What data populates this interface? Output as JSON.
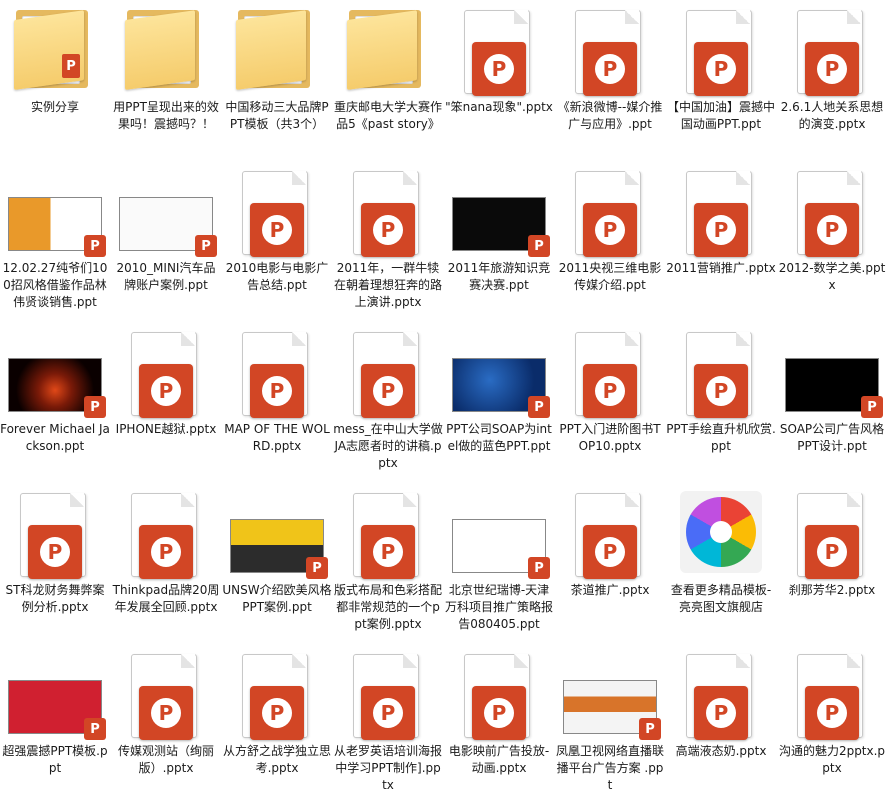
{
  "icons": {
    "ppt_letter": "P",
    "colors": {
      "ppt_red": "#d24625",
      "folder_yellow": "#f5cc6c"
    }
  },
  "files": [
    {
      "label": "实例分享",
      "kind": "folder",
      "icon": "folder-icon"
    },
    {
      "label": "用PPT呈现出来的效果吗！震撼吗？！",
      "kind": "folder",
      "icon": "folder-icon"
    },
    {
      "label": "中国移动三大品牌PPT模板（共3个）",
      "kind": "folder",
      "icon": "folder-icon"
    },
    {
      "label": "重庆邮电大学大赛作品5《past story》",
      "kind": "folder",
      "icon": "folder-icon"
    },
    {
      "label": "\"笨nana现象\".pptx",
      "kind": "doc",
      "icon": "pptx-icon"
    },
    {
      "label": "《新浪微博--媒介推广与应用》.ppt",
      "kind": "doc",
      "icon": "pptx-icon"
    },
    {
      "label": "【中国加油】震撼中国动画PPT.ppt",
      "kind": "doc",
      "icon": "pptx-icon"
    },
    {
      "label": "2.6.1人地关系思想的演变.pptx",
      "kind": "doc",
      "icon": "pptx-icon"
    },
    {
      "label": "12.02.27纯爷们100招风格借鉴作品林伟贤谈销售.ppt",
      "kind": "thumb",
      "thumb": "t-orange",
      "icon": "ppt-thumbnail-icon"
    },
    {
      "label": "2010_MINI汽车品牌账户案例.ppt",
      "kind": "thumb",
      "thumb": "t-white",
      "icon": "ppt-thumbnail-icon"
    },
    {
      "label": "2010电影与电影广告总结.ppt",
      "kind": "doc",
      "icon": "pptx-icon"
    },
    {
      "label": "2011年，一群牛犊在朝着理想狂奔的路上演讲.pptx",
      "kind": "doc",
      "icon": "pptx-icon"
    },
    {
      "label": "2011年旅游知识竞赛决赛.ppt",
      "kind": "thumb",
      "thumb": "t-black",
      "icon": "ppt-thumbnail-icon"
    },
    {
      "label": "2011央视三维电影传媒介绍.ppt",
      "kind": "doc",
      "icon": "pptx-icon"
    },
    {
      "label": "2011营销推广.pptx",
      "kind": "doc",
      "icon": "pptx-icon"
    },
    {
      "label": "2012-数学之美.pptx",
      "kind": "doc",
      "icon": "pptx-icon"
    },
    {
      "label": "Forever Michael Jackson.ppt",
      "kind": "thumb",
      "thumb": "t-fire",
      "icon": "ppt-thumbnail-icon"
    },
    {
      "label": "IPHONE越狱.pptx",
      "kind": "doc",
      "icon": "pptx-icon"
    },
    {
      "label": "MAP OF THE WOLRD.pptx",
      "kind": "doc",
      "icon": "pptx-icon"
    },
    {
      "label": "mess_在中山大学做JA志愿者时的讲稿.pptx",
      "kind": "doc",
      "icon": "pptx-icon"
    },
    {
      "label": "PPT公司SOAP为intel做的蓝色PPT.ppt",
      "kind": "thumb",
      "thumb": "t-intel",
      "icon": "ppt-thumbnail-icon"
    },
    {
      "label": "PPT入门进阶图书TOP10.pptx",
      "kind": "doc",
      "icon": "pptx-icon"
    },
    {
      "label": "PPT手绘直升机欣赏.ppt",
      "kind": "doc",
      "icon": "pptx-icon"
    },
    {
      "label": "SOAP公司广告风格PPT设计.ppt",
      "kind": "thumb",
      "thumb": "t-soap",
      "icon": "ppt-thumbnail-icon"
    },
    {
      "label": "ST科龙财务舞弊案例分析.pptx",
      "kind": "doc",
      "icon": "pptx-icon"
    },
    {
      "label": "Thinkpad品牌20周年发展全回顾.pptx",
      "kind": "doc",
      "icon": "pptx-icon"
    },
    {
      "label": "UNSW介绍欧美风格PPT案例.ppt",
      "kind": "thumb",
      "thumb": "t-unsw",
      "icon": "ppt-thumbnail-icon"
    },
    {
      "label": "版式布局和色彩搭配都非常规范的一个ppt案例.pptx",
      "kind": "doc",
      "icon": "pptx-icon"
    },
    {
      "label": "北京世纪瑞博-天津万科项目推广策略报告080405.ppt",
      "kind": "thumb",
      "thumb": "t-glyph",
      "icon": "ppt-thumbnail-icon"
    },
    {
      "label": "茶道推广.pptx",
      "kind": "doc",
      "icon": "pptx-icon"
    },
    {
      "label": "查看更多精品模板-亮亮图文旗舰店",
      "kind": "store",
      "icon": "store-logo-icon"
    },
    {
      "label": "刹那芳华2.pptx",
      "kind": "doc",
      "icon": "pptx-icon"
    },
    {
      "label": "超强震撼PPT模板.ppt",
      "kind": "thumb",
      "thumb": "t-red",
      "icon": "ppt-thumbnail-icon"
    },
    {
      "label": "传媒观测站（绚丽版）.pptx",
      "kind": "doc",
      "icon": "pptx-icon"
    },
    {
      "label": "从方舒之战学独立思考.pptx",
      "kind": "doc",
      "icon": "pptx-icon"
    },
    {
      "label": "从老罗英语培训海报中学习PPT制作].pptx",
      "kind": "doc",
      "icon": "pptx-icon"
    },
    {
      "label": "电影映前广告投放-动画.pptx",
      "kind": "doc",
      "icon": "pptx-icon"
    },
    {
      "label": "凤凰卫视网络直播联播平台广告方案 .ppt",
      "kind": "thumb",
      "thumb": "t-phoenix",
      "icon": "ppt-thumbnail-icon"
    },
    {
      "label": "高端液态奶.pptx",
      "kind": "doc",
      "icon": "pptx-icon"
    },
    {
      "label": "沟通的魅力2pptx.pptx",
      "kind": "doc",
      "icon": "pptx-icon"
    }
  ]
}
